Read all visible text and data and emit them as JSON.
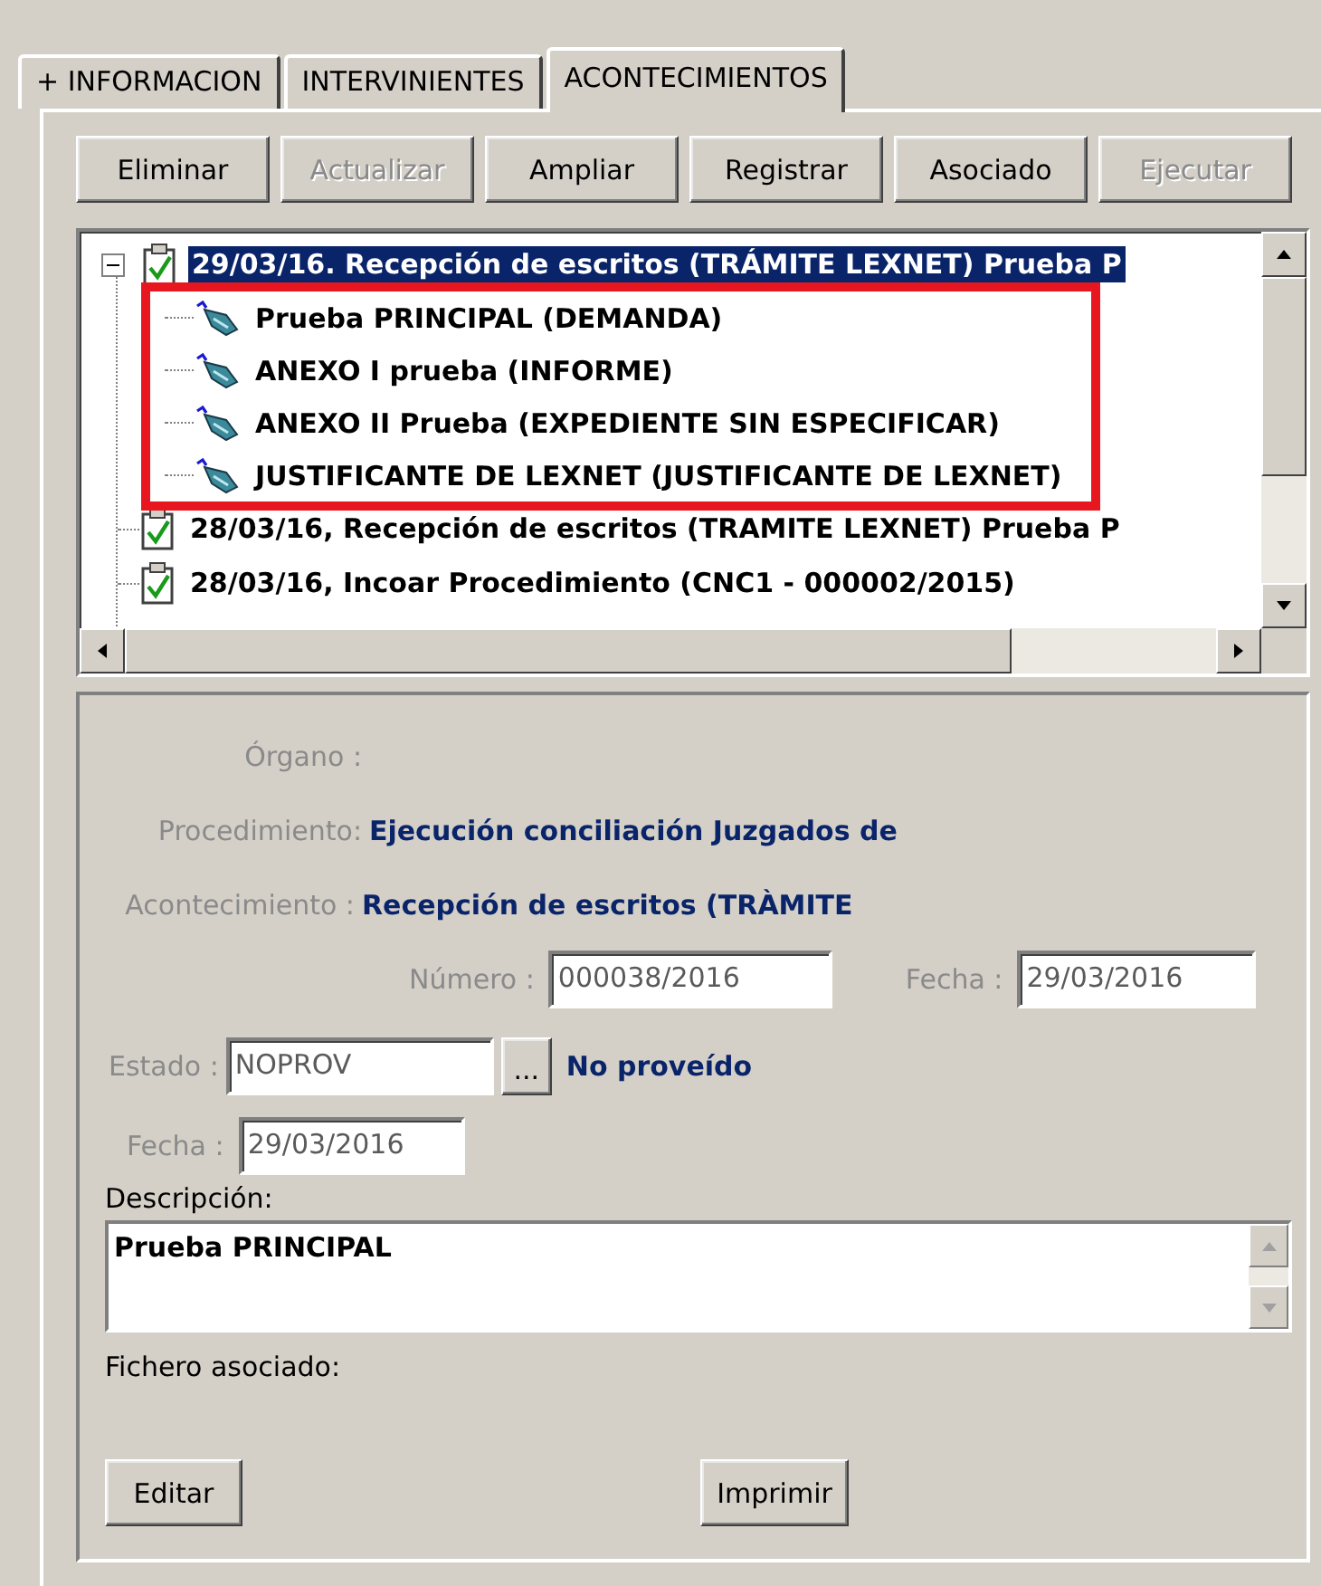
{
  "tabs": [
    {
      "label": "+ INFORMACION",
      "selected": false
    },
    {
      "label": "INTERVINIENTES",
      "selected": false
    },
    {
      "label": "ACONTECIMIENTOS",
      "selected": true
    }
  ],
  "toolbar": [
    {
      "label": "Eliminar",
      "disabled": false
    },
    {
      "label": "Actualizar",
      "disabled": true
    },
    {
      "label": "Ampliar",
      "disabled": false
    },
    {
      "label": "Registrar",
      "disabled": false
    },
    {
      "label": "Asociado",
      "disabled": false
    },
    {
      "label": "Ejecutar",
      "disabled": true
    }
  ],
  "tree": {
    "nodes": [
      {
        "label": "29/03/16. Recepción de escritos (TRÁMITE LEXNET) Prueba P",
        "selected": true,
        "expanded": true,
        "highlight_children": true,
        "children": [
          {
            "label": "Prueba PRINCIPAL (DEMANDA)"
          },
          {
            "label": "ANEXO I prueba (INFORME)"
          },
          {
            "label": "ANEXO II Prueba (EXPEDIENTE SIN ESPECIFICAR)"
          },
          {
            "label": "JUSTIFICANTE DE LEXNET (JUSTIFICANTE DE LEXNET)"
          }
        ]
      },
      {
        "label": "28/03/16, Recepción de escritos (TRAMITE LEXNET) Prueba P",
        "selected": false
      },
      {
        "label": "28/03/16, Incoar Procedimiento (CNC1 - 000002/2015)",
        "selected": false
      }
    ]
  },
  "detail": {
    "organo": {
      "label": "Órgano :"
    },
    "procedimiento": {
      "label": "Procedimiento:",
      "value": "Ejecución conciliación Juzgados de"
    },
    "acontecimiento": {
      "label": "Acontecimiento :",
      "value": "Recepción de escritos (TRÀMITE"
    },
    "numero": {
      "label": "Número :",
      "value": "000038/2016",
      "disabled": true
    },
    "fecha": {
      "label": "Fecha :",
      "value": "29/03/2016",
      "disabled": true
    },
    "estado": {
      "label": "Estado :",
      "value": "NOPROV",
      "disabled": true,
      "button": "...",
      "description": "No proveído"
    },
    "fecha_estado": {
      "label": "Fecha :",
      "value": "29/03/2016",
      "disabled": true
    },
    "descripcion": {
      "label": "Descripción:",
      "value": "Prueba PRINCIPAL"
    },
    "fichero": {
      "label": "Fichero asociado:"
    },
    "buttons": [
      {
        "label": "Editar"
      },
      {
        "label": "Imprimir"
      }
    ]
  }
}
